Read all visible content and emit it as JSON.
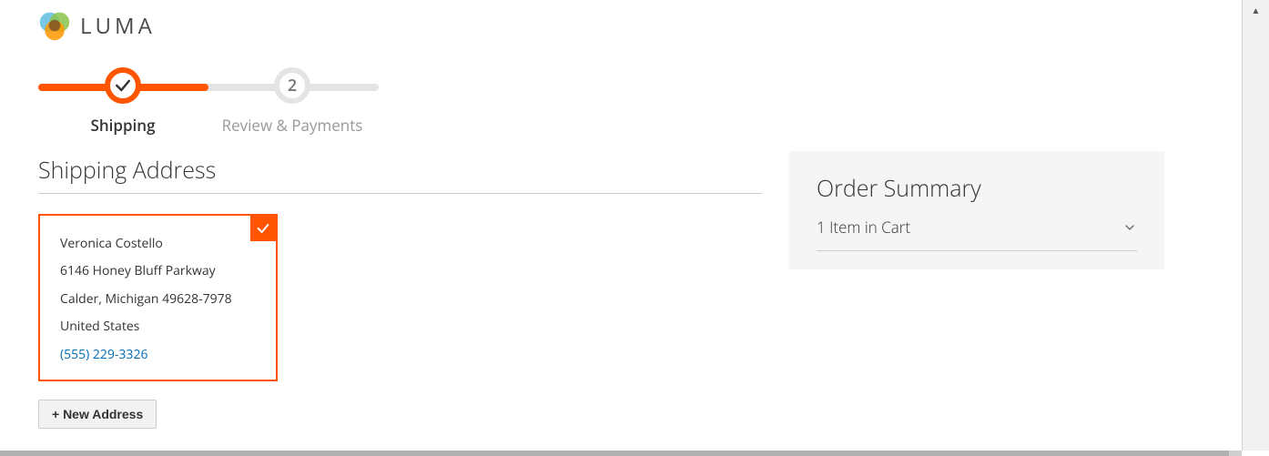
{
  "brand": {
    "name": "LUMA"
  },
  "progress": {
    "steps": [
      {
        "label": "Shipping",
        "state": "active"
      },
      {
        "label": "Review & Payments",
        "state": "pending",
        "number": "2"
      }
    ]
  },
  "shipping": {
    "title": "Shipping Address",
    "address": {
      "name": "Veronica Costello",
      "street": "6146 Honey Bluff Parkway",
      "city_state_zip": "Calder, Michigan 49628-7978",
      "country": "United States",
      "phone": "(555) 229-3326"
    },
    "new_address_label": "+ New Address"
  },
  "summary": {
    "title": "Order Summary",
    "cart_line": "1 Item in Cart"
  }
}
